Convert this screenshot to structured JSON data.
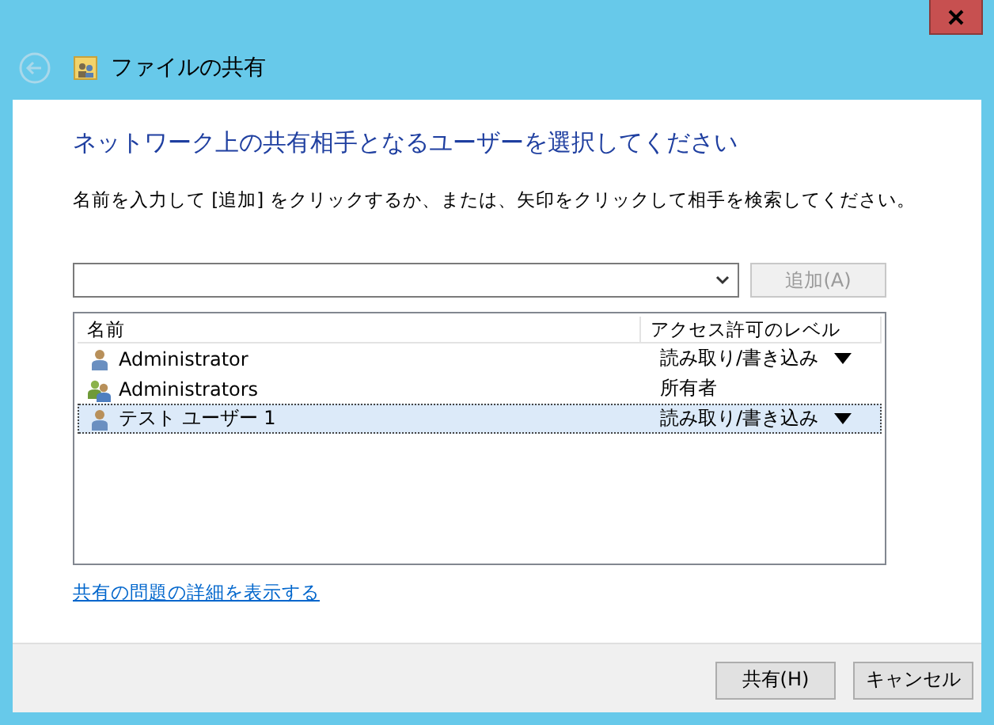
{
  "window": {
    "title": "ファイルの共有"
  },
  "heading": "ネットワーク上の共有相手となるユーザーを選択してください",
  "instruction": "名前を入力して [追加] をクリックするか、または、矢印をクリックして相手を検索してください。",
  "add_button": {
    "label": "追加(A)",
    "disabled": true
  },
  "table": {
    "columns": [
      "名前",
      "アクセス許可のレベル"
    ],
    "rows": [
      {
        "kind": "user",
        "name": "Administrator",
        "permission": "読み取り/書き込み",
        "dropdown": true,
        "selected": false
      },
      {
        "kind": "group",
        "name": "Administrators",
        "permission": "所有者",
        "dropdown": false,
        "selected": false
      },
      {
        "kind": "user",
        "name": "テスト ユーザー 1",
        "permission": "読み取り/書き込み",
        "dropdown": true,
        "selected": true
      }
    ]
  },
  "link": "共有の問題の詳細を表示する",
  "buttons": [
    "共有(H)",
    "キャンセル"
  ]
}
